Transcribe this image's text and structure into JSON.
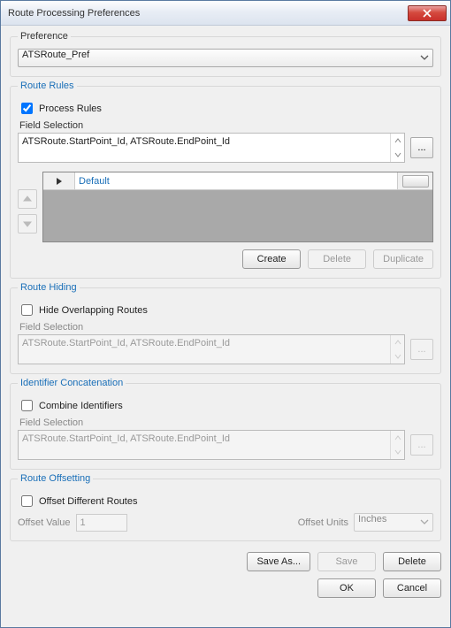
{
  "window": {
    "title": "Route Processing Preferences"
  },
  "preference": {
    "legend": "Preference",
    "selected": "ATSRoute_Pref"
  },
  "route_rules": {
    "legend": "Route Rules",
    "process_rules_label": "Process Rules",
    "process_rules_checked": true,
    "field_selection_label": "Field Selection",
    "field_selection_value": "ATSRoute.StartPoint_Id, ATSRoute.EndPoint_Id",
    "grid": {
      "rows": [
        {
          "name": "Default"
        }
      ]
    },
    "buttons": {
      "create": "Create",
      "delete": "Delete",
      "duplicate": "Duplicate"
    }
  },
  "route_hiding": {
    "legend": "Route Hiding",
    "hide_label": "Hide Overlapping Routes",
    "hide_checked": false,
    "field_selection_label": "Field Selection",
    "field_selection_value": "ATSRoute.StartPoint_Id, ATSRoute.EndPoint_Id"
  },
  "identifier_concat": {
    "legend": "Identifier Concatenation",
    "combine_label": "Combine Identifiers",
    "combine_checked": false,
    "field_selection_label": "Field Selection",
    "field_selection_value": "ATSRoute.StartPoint_Id, ATSRoute.EndPoint_Id"
  },
  "route_offsetting": {
    "legend": "Route Offsetting",
    "offset_diff_label": "Offset Different Routes",
    "offset_diff_checked": false,
    "offset_value_label": "Offset Value",
    "offset_value": "1",
    "offset_units_label": "Offset Units",
    "offset_units_selected": "Inches"
  },
  "footer": {
    "save_as": "Save As...",
    "save": "Save",
    "delete": "Delete",
    "ok": "OK",
    "cancel": "Cancel"
  },
  "icons": {
    "dots": "..."
  }
}
